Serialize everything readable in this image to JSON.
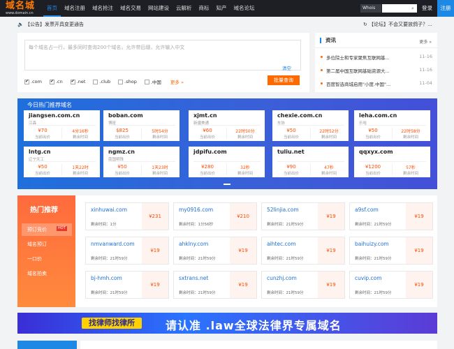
{
  "header": {
    "logo_text": "域名城",
    "logo_sub": "www.domain.cn",
    "nav": [
      {
        "label": "首页",
        "active": true
      },
      {
        "label": "域名注册"
      },
      {
        "label": "域名抢注"
      },
      {
        "label": "域名交易"
      },
      {
        "label": "网站建设"
      },
      {
        "label": "云解析"
      },
      {
        "label": "商标"
      },
      {
        "label": "知产"
      },
      {
        "label": "域名论坛"
      }
    ],
    "whois_label": "Whois",
    "login": "登录",
    "register": "注册"
  },
  "notice": "【公告】发票开具变更通告",
  "forum": "【论坛】不会又要放鸽子？...",
  "search": {
    "placeholder": "每个域名占一行，最多同时查询200个域名，允许带后缀，允许输入中文",
    "clear": "清空",
    "tlds": [
      {
        "label": ".com",
        "checked": true
      },
      {
        "label": ".cn",
        "checked": true
      },
      {
        "label": ".net",
        "checked": true
      },
      {
        "label": ".club",
        "checked": false
      },
      {
        "label": ".shop",
        "checked": false
      },
      {
        "label": ".中国",
        "checked": false
      }
    ],
    "more": "更多 »",
    "batch_button": "批量查询"
  },
  "news": {
    "title": "资讯",
    "more": "更多 »",
    "items": [
      {
        "title": "多位院士和专家聚焦互联网基...",
        "date": "11-16"
      },
      {
        "title": "第二届中国互联网基础资源大...",
        "date": "11-16"
      },
      {
        "title": "百度智选商城启用\"小度.中国\"...",
        "date": "11-04"
      }
    ]
  },
  "hot": {
    "title": "今日热门推荐域名",
    "price_label": "当前出价",
    "time_label": "剩余时间",
    "cards": [
      {
        "name": "jiangsen.com.cn",
        "desc": "江森",
        "price": "¥70",
        "time": "4分16秒"
      },
      {
        "name": "boban.com",
        "desc": "博班",
        "price": "$825",
        "time": "5时54分"
      },
      {
        "name": "xjmt.cn",
        "desc": "新疆美通",
        "price": "¥60",
        "time": "22时50分"
      },
      {
        "name": "chexie.com.cn",
        "desc": "车协",
        "price": "¥50",
        "time": "22时52分"
      },
      {
        "name": "leha.com.cn",
        "desc": "乐哈",
        "price": "¥50",
        "time": "22时58分"
      },
      {
        "name": "lntg.cn",
        "desc": "辽宁天工",
        "price": "¥50",
        "time": "1天22时"
      },
      {
        "name": "ngmz.cn",
        "desc": "南国明珠",
        "price": "¥50",
        "time": "1天23时"
      },
      {
        "name": "jdpifu.com",
        "desc": "",
        "price": "¥280",
        "time": "32秒"
      },
      {
        "name": "tuliu.net",
        "desc": "",
        "price": "¥90",
        "time": "47秒"
      },
      {
        "name": "qqxyx.com",
        "desc": "",
        "price": "¥1200",
        "time": "57秒"
      }
    ]
  },
  "recommend": {
    "title": "热门推荐",
    "menu": [
      {
        "label": "预订竞价",
        "badge": "HOT"
      },
      {
        "label": "域名预订"
      },
      {
        "label": "一口价"
      },
      {
        "label": "域名拍卖"
      }
    ],
    "left_prefix": "剩余时间：",
    "cards": [
      {
        "name": "xinhuwai.com",
        "left": "1分",
        "price": "¥231"
      },
      {
        "name": "my0916.com",
        "left": "1分56秒",
        "price": "¥210"
      },
      {
        "name": "52linjia.com",
        "left": "21时59分",
        "price": "¥19"
      },
      {
        "name": "a9sf.com",
        "left": "21时59分",
        "price": "¥19"
      },
      {
        "name": "nmvanward.com",
        "left": "21时59分",
        "price": "¥19"
      },
      {
        "name": "ahklny.com",
        "left": "21时59分",
        "price": "¥19"
      },
      {
        "name": "aihtec.com",
        "left": "21时59分",
        "price": "¥19"
      },
      {
        "name": "baihuizy.com",
        "left": "21时59分",
        "price": "¥19"
      },
      {
        "name": "bj-hmh.com",
        "left": "21时59分",
        "price": "¥19"
      },
      {
        "name": "sxtrans.net",
        "left": "21时59分",
        "price": "¥19"
      },
      {
        "name": "cunzhj.com",
        "left": "21时59分",
        "price": "¥19"
      },
      {
        "name": "cuvip.com",
        "left": "21时59分",
        "price": "¥19"
      }
    ]
  },
  "banner": {
    "left": "找律师找律所",
    "right": "请认准 .law全球法律界专属域名"
  }
}
